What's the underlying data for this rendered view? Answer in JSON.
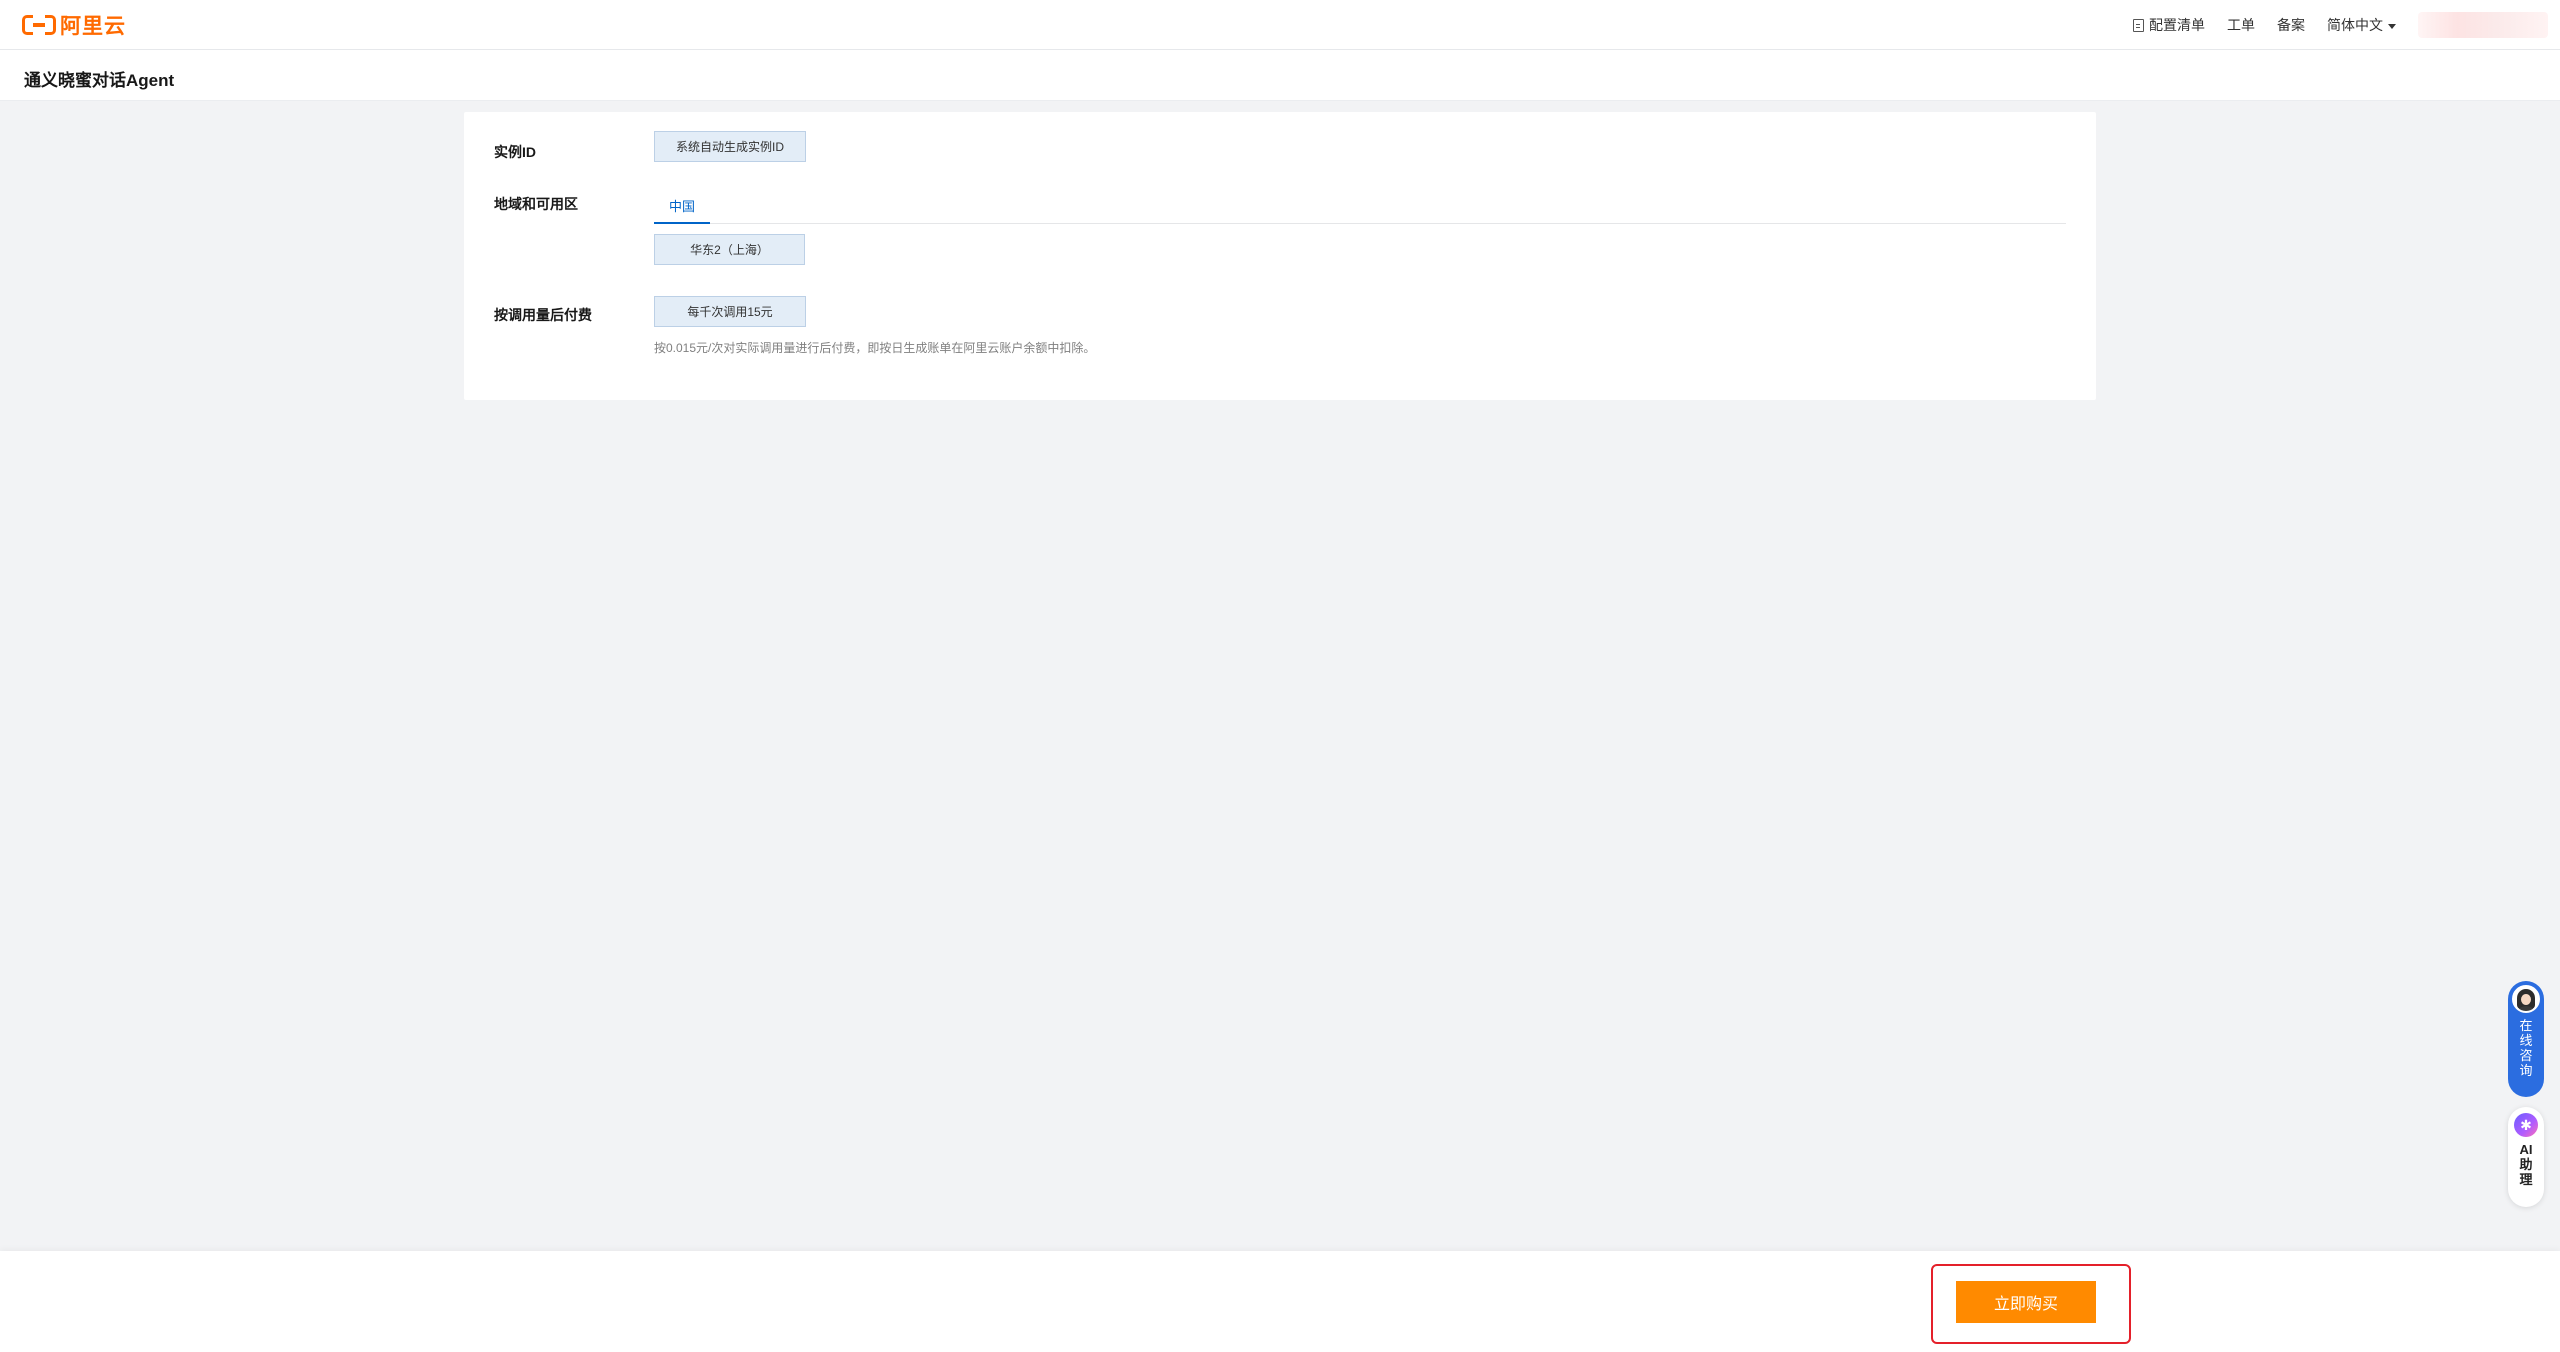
{
  "header": {
    "logo_text": "阿里云",
    "links": {
      "config_list": "配置清单",
      "ticket": "工单",
      "beian": "备案",
      "language": "简体中文"
    }
  },
  "page": {
    "title": "通义晓蜜对话Agent"
  },
  "form": {
    "instance_id": {
      "label": "实例ID",
      "value": "系统自动生成实例ID"
    },
    "region": {
      "label": "地域和可用区",
      "tab": "中国",
      "zone": "华东2（上海）"
    },
    "billing": {
      "label": "按调用量后付费",
      "option": "每千次调用15元",
      "hint": "按0.015元/次对实际调用量进行后付费，即按日生成账单在阿里云账户余额中扣除。"
    }
  },
  "footer": {
    "buy_label": "立即购买"
  },
  "widgets": {
    "consult_label": "在线咨询",
    "ai_label": "AI助理"
  },
  "colors": {
    "brand": "#ff6a00",
    "buy_button": "#ff8a00",
    "tab_active": "#0064c8",
    "highlight": "#e4202a"
  }
}
